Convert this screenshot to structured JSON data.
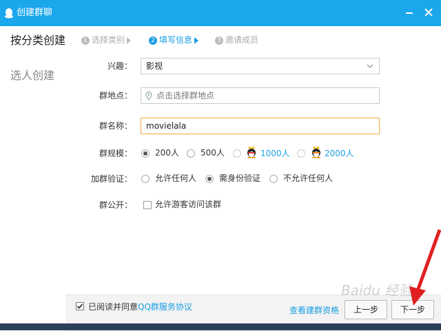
{
  "window": {
    "title": "创建群聊"
  },
  "sidebar": {
    "items": [
      {
        "label": "按分类创建",
        "active": true
      },
      {
        "label": "选人创建",
        "active": false
      }
    ]
  },
  "steps": [
    {
      "num": "1",
      "label": "选择类别"
    },
    {
      "num": "2",
      "label": "填写信息"
    },
    {
      "num": "3",
      "label": "邀请成员"
    }
  ],
  "form": {
    "interest": {
      "label": "兴趣：",
      "value": "影视"
    },
    "location": {
      "label": "群地点：",
      "placeholder": "点击选择群地点"
    },
    "name": {
      "label": "群名称：",
      "value": "movielala"
    },
    "size": {
      "label": "群规模：",
      "options": [
        "200人",
        "500人",
        "1000人",
        "2000人"
      ],
      "selected": "200人"
    },
    "verify": {
      "label": "加群验证：",
      "options": [
        "允许任何人",
        "需身份验证",
        "不允许任何人"
      ],
      "selected": "需身份验证"
    },
    "public": {
      "label": "群公开：",
      "checkbox_label": "允许游客访问该群",
      "checked": false
    }
  },
  "footer": {
    "agree_prefix": "已阅读并同意",
    "agree_link": "QQ群服务协议",
    "agree_checked": true,
    "view_link": "查看建群资格",
    "prev_button": "上一步",
    "next_button": "下一步"
  },
  "watermark": "Baidu 经验",
  "colors": {
    "titlebar": "#1aa7ec",
    "accent": "#1a9de2",
    "focus_border": "#f5b25a",
    "annotation_arrow": "#e02020"
  }
}
